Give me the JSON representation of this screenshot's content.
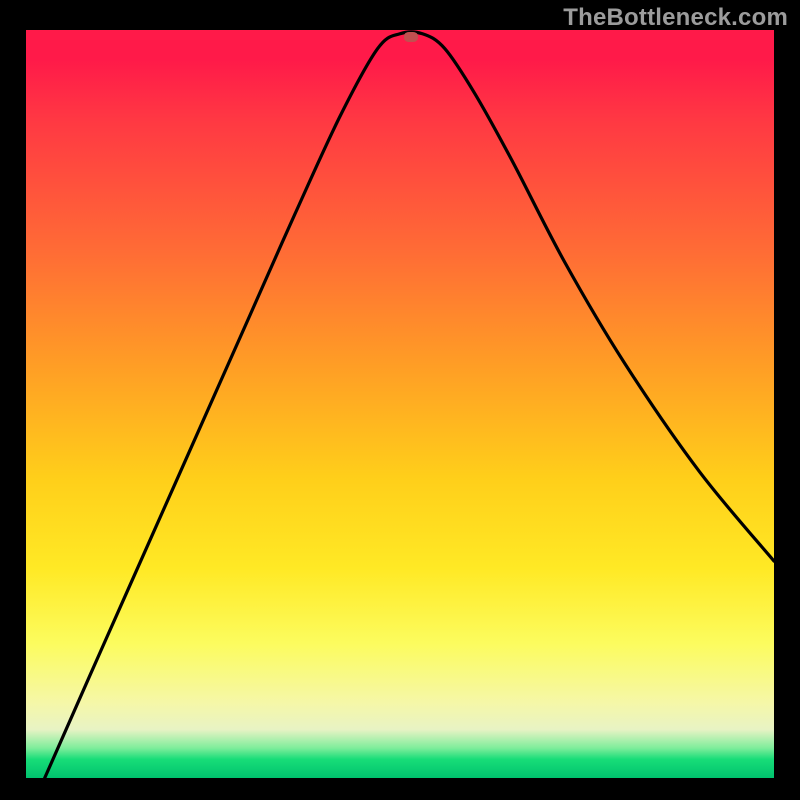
{
  "watermark": "TheBottleneck.com",
  "chart_data": {
    "type": "line",
    "title": "",
    "xlabel": "",
    "ylabel": "",
    "xlim": [
      0,
      100
    ],
    "ylim": [
      0,
      100
    ],
    "grid": false,
    "series": [
      {
        "name": "curve",
        "x": [
          2.5,
          10,
          20,
          30,
          36,
          42,
          47,
          50,
          53,
          56,
          60,
          65,
          72,
          80,
          90,
          100
        ],
        "values": [
          0,
          17,
          39.5,
          62,
          75.5,
          88.5,
          97.5,
          99.5,
          99.5,
          97.5,
          91.5,
          82.5,
          69,
          55.5,
          41,
          29
        ]
      }
    ],
    "marker": {
      "x": 51.5,
      "y": 99
    },
    "gradient_stops": [
      {
        "pos": 0,
        "color": "#ff1a49"
      },
      {
        "pos": 0.3,
        "color": "#ff6d35"
      },
      {
        "pos": 0.6,
        "color": "#ffcf1a"
      },
      {
        "pos": 0.82,
        "color": "#fcfc5e"
      },
      {
        "pos": 0.96,
        "color": "#7eed9b"
      },
      {
        "pos": 1.0,
        "color": "#00c26e"
      }
    ]
  }
}
